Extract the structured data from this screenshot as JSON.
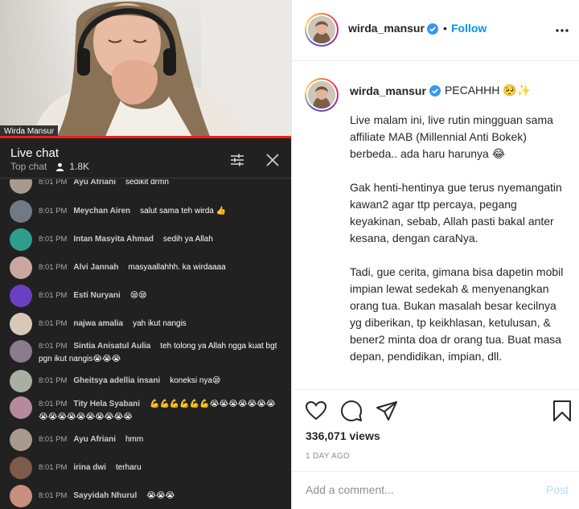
{
  "video": {
    "caption": "Wirda Mansur"
  },
  "live_chat": {
    "title": "Live chat",
    "mode": "Top chat",
    "viewers": "1.8K",
    "messages": [
      {
        "time": "8:01 PM",
        "name": "Ayu Afriani",
        "text": "sedikit drmn",
        "avatar_color": "#a89a8c"
      },
      {
        "time": "8:01 PM",
        "name": "Meychan Airen",
        "text": "salut sama teh wirda 👍",
        "avatar_color": "#6f7a86"
      },
      {
        "time": "8:01 PM",
        "name": "Intan Masyita Ahmad",
        "text": "sedih ya Allah",
        "avatar_color": "#2e9e8a"
      },
      {
        "time": "8:01 PM",
        "name": "Alvi Jannah",
        "text": "masyaallahhh. ka wirdaaaa",
        "avatar_color": "#c9a7a0"
      },
      {
        "time": "8:01 PM",
        "name": "Esti Nuryani",
        "text": "😪😪",
        "avatar_color": "#6b3fc2"
      },
      {
        "time": "8:01 PM",
        "name": "najwa amalia",
        "text": "yah ikut nangis",
        "avatar_color": "#d9c7b8"
      },
      {
        "time": "8:01 PM",
        "name": "Sintia Anisatul Aulia",
        "text": "teh tolong ya Allah ngga kuat bgt pgn ikut nangis😭😭😭",
        "avatar_color": "#8a7b8e"
      },
      {
        "time": "8:01 PM",
        "name": "Gheitsya adellia insani",
        "text": "koneksi nya😪",
        "avatar_color": "#a7b0a3"
      },
      {
        "time": "8:01 PM",
        "name": "Tity Hela Syabani",
        "text": "💪💪💪💪💪💪😭😭😭😭😭😭😭😭😭😭😭😭😭😭😭😭😭",
        "avatar_color": "#b58a9c"
      },
      {
        "time": "8:01 PM",
        "name": "Ayu Afriani",
        "text": "hmm",
        "avatar_color": "#a89a8c"
      },
      {
        "time": "8:01 PM",
        "name": "irina dwi",
        "text": "terharu",
        "avatar_color": "#7d5a4a"
      },
      {
        "time": "8:01 PM",
        "name": "Sayyidah Nhurul",
        "text": "😭😭😭",
        "avatar_color": "#c98f7e"
      }
    ]
  },
  "post": {
    "username": "wirda_mansur",
    "follow_label": "Follow",
    "follow_separator": "•",
    "caption_lead": "PECAHHH 🥺✨",
    "caption_paragraphs": [
      "Live malam ini, live rutin mingguan sama affiliate MAB (Millennial Anti Bokek) berbeda.. ada haru harunya 😂",
      "Gak henti-hentinya gue terus nyemangatin kawan2 agar ttp percaya, pegang keyakinan, sebab, Allah pasti bakal anter kesana, dengan caraNya.",
      "Tadi, gue cerita, gimana bisa dapetin mobil impian lewat sedekah & menyenangkan orang tua. Bukan masalah besar kecilnya yg diberikan, tp keikhlasan, ketulusan, & bener2 minta doa dr orang tua. Buat masa depan, pendidikan, impian, dll."
    ],
    "views": "336,071 views",
    "date": "1 DAY AGO",
    "comment_placeholder": "Add a comment...",
    "post_label": "Post",
    "accent_color": "#0095f6"
  }
}
